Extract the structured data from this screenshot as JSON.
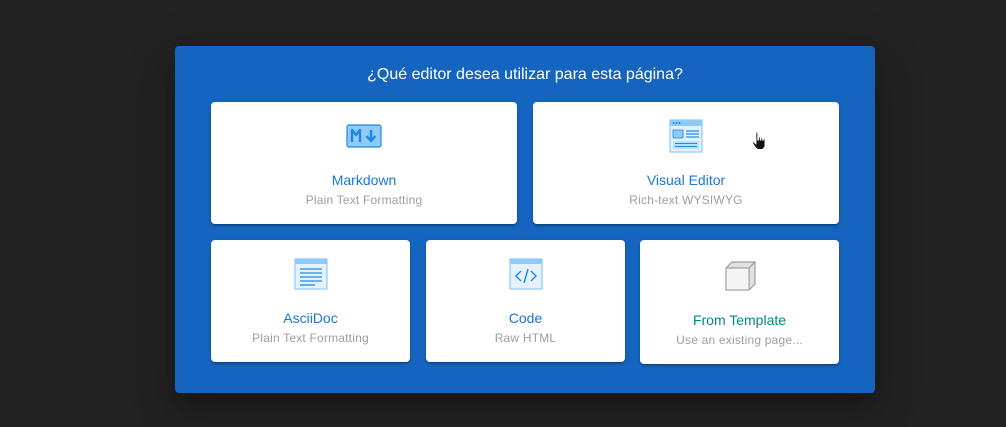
{
  "dialog": {
    "title": "¿Qué editor desea utilizar para esta página?"
  },
  "editors": {
    "markdown": {
      "title": "Markdown",
      "subtitle": "Plain Text Formatting",
      "icon": "markdown-icon"
    },
    "visual": {
      "title": "Visual Editor",
      "subtitle": "Rich-text WYSIWYG",
      "icon": "web-page-icon"
    },
    "asciidoc": {
      "title": "AsciiDoc",
      "subtitle": "Plain Text Formatting",
      "icon": "document-window-icon"
    },
    "code": {
      "title": "Code",
      "subtitle": "Raw HTML",
      "icon": "code-window-icon"
    },
    "template": {
      "title": "From Template",
      "subtitle": "Use an existing page...",
      "icon": "cube-icon"
    }
  },
  "colors": {
    "background": "#232323",
    "dialog": "#1565c0",
    "card_title": "#1976d2",
    "template_title": "#00897b",
    "subtitle": "#9e9e9e",
    "icon_light": "#90caf9",
    "icon_dark": "#1e88e5"
  }
}
